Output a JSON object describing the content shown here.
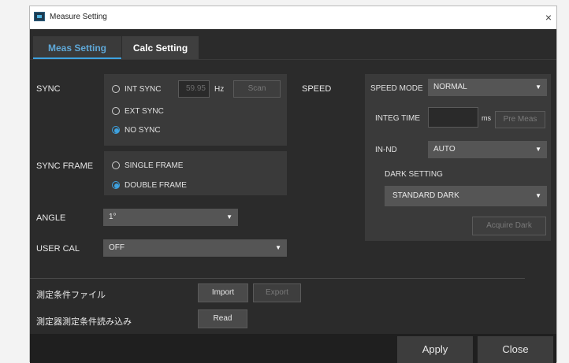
{
  "window": {
    "title": "Measure Setting",
    "close": "×"
  },
  "tabs": [
    {
      "label": "Meas Setting"
    },
    {
      "label": "Calc Setting"
    }
  ],
  "sync": {
    "label": "SYNC",
    "int_sync": "INT SYNC",
    "hz_value": "59.95",
    "hz_unit": "Hz",
    "scan": "Scan",
    "ext_sync": "EXT SYNC",
    "no_sync": "NO SYNC",
    "selected": "NO SYNC"
  },
  "sync_frame": {
    "label": "SYNC FRAME",
    "single": "SINGLE FRAME",
    "double": "DOUBLE FRAME",
    "selected": "DOUBLE FRAME"
  },
  "angle": {
    "label": "ANGLE",
    "value": "1°"
  },
  "user_cal": {
    "label": "USER CAL",
    "value": "OFF"
  },
  "speed": {
    "label": "SPEED",
    "mode_label": "SPEED MODE",
    "mode_value": "NORMAL",
    "integ_label": "INTEG TIME",
    "integ_value": "",
    "integ_unit": "ms",
    "pre_meas": "Pre Meas",
    "innd_label": "IN-ND",
    "innd_value": "AUTO",
    "dark_label": "DARK SETTING",
    "dark_value": "STANDARD DARK",
    "acquire_dark": "Acquire Dark"
  },
  "files": {
    "cond_file_label": "測定条件ファイル",
    "import": "Import",
    "export": "Export",
    "device_read_label": "測定器測定条件読み込み",
    "read": "Read"
  },
  "footer": {
    "apply": "Apply",
    "close": "Close"
  }
}
